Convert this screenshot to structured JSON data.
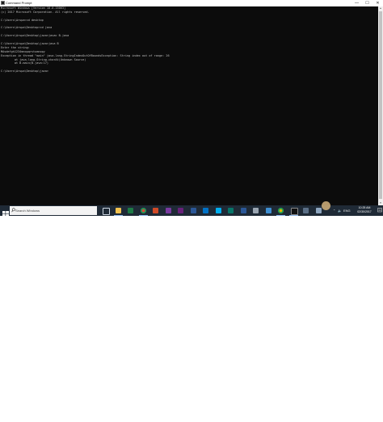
{
  "window": {
    "title": "Command Prompt",
    "minimize": "—",
    "maximize": "☐",
    "close": "✕"
  },
  "console": {
    "lines": [
      "Microsoft Windows [Version 10.0.15063]",
      "(c) 2017 Microsoft Corporation. All rights reserved.",
      "",
      "C:\\Users\\Arupa>cd desktop",
      "",
      "C:\\Users\\Arupa\\Desktop>cd java",
      "",
      "C:\\Users\\Arupa\\Desktop\\java>javac B.java",
      "",
      "C:\\Users\\Arupa\\Desktop\\java>java B",
      "Enter the string:",
      "MAsdefgh1234mnopqrstumnopy",
      "Exception in thread \"main\" java.lang.StringIndexOutOfBoundsException: String index out of range: 26",
      "        at java.lang.String.charAt(Unknown Source)",
      "        at B.main(B.java:17)",
      "",
      "C:\\Users\\Arupa\\Desktop\\java>"
    ]
  },
  "scrollbar": {
    "up": "▲",
    "down": "▼"
  },
  "taskbar": {
    "search_placeholder": "Search Windows",
    "colors": {
      "background": "#1f2a36",
      "console": "#0c0c0c",
      "console_text": "#c0c0c0"
    },
    "icons": [
      {
        "name": "task-view-icon",
        "color": "#1f2a36",
        "active": false
      },
      {
        "name": "file-explorer-icon",
        "color": "#f2c24f",
        "active": true
      },
      {
        "name": "excel-icon",
        "color": "#1d7a45",
        "active": false
      },
      {
        "name": "chrome-icon",
        "color": "#db4437",
        "active": true
      },
      {
        "name": "powerpoint-icon",
        "color": "#d04a27",
        "active": false
      },
      {
        "name": "onenote-icon",
        "color": "#7a3aa0",
        "active": false
      },
      {
        "name": "visual-studio-icon",
        "color": "#68217a",
        "active": false
      },
      {
        "name": "word-icon",
        "color": "#2b5797",
        "active": false
      },
      {
        "name": "outlook-icon",
        "color": "#0072c6",
        "active": false
      },
      {
        "name": "skype-icon",
        "color": "#00aff0",
        "active": false
      },
      {
        "name": "publisher-icon",
        "color": "#077568",
        "active": false
      },
      {
        "name": "word-document-icon",
        "color": "#2b5797",
        "active": false
      },
      {
        "name": "settings-icon",
        "color": "#9aa5b1",
        "active": false
      },
      {
        "name": "paint-icon",
        "color": "#3f8fd2",
        "active": false
      },
      {
        "name": "chrome-window-icon",
        "color": "#e4b400",
        "active": true
      },
      {
        "name": "command-prompt-icon",
        "color": "#111111",
        "active": true
      },
      {
        "name": "store-icon",
        "color": "#5b6f86",
        "active": false
      },
      {
        "name": "app-icon",
        "color": "#8da5be",
        "active": false
      }
    ],
    "tray": {
      "chevron": "⌃",
      "volume": "🔈",
      "battery": "ENG"
    },
    "clock_time": "10:25 AM",
    "clock_date": "02/30/2017"
  }
}
